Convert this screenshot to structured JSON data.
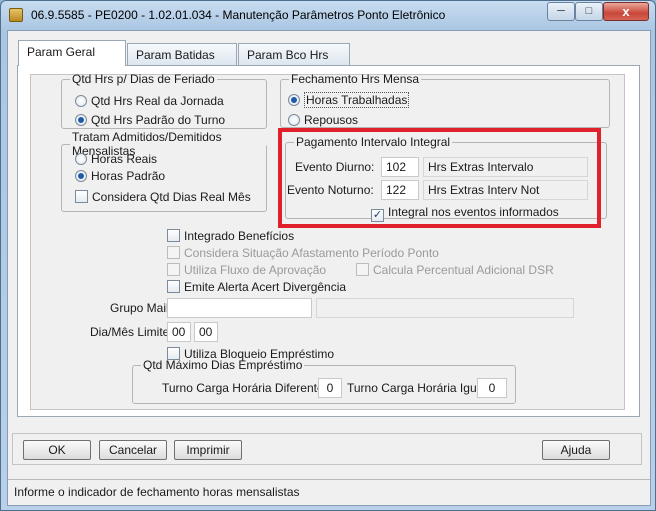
{
  "window": {
    "title": "06.9.5585 - PE0200 - 1.02.01.034 - Manutenção Parâmetros Ponto Eletrônico",
    "controls": {
      "close_label": "x"
    }
  },
  "tabs": [
    {
      "label": "Param Geral",
      "selected": true
    },
    {
      "label": "Param Batidas",
      "selected": false
    },
    {
      "label": "Param Bco Hrs",
      "selected": false
    }
  ],
  "feriado": {
    "legend": "Qtd Hrs p/ Dias de Feriado",
    "options": [
      {
        "label": "Qtd Hrs Real da Jornada",
        "selected": false
      },
      {
        "label": "Qtd Hrs Padrão do Turno",
        "selected": true
      }
    ]
  },
  "fechamento": {
    "legend": "Fechamento Hrs Mensa",
    "options": [
      {
        "label": "Horas Trabalhadas",
        "selected": true
      },
      {
        "label": "Repousos",
        "selected": false
      }
    ]
  },
  "admitidos": {
    "legend": "Tratam Admitidos/Demitidos Mensalistas",
    "options": [
      {
        "label": "Horas Reais",
        "selected": false
      },
      {
        "label": "Horas Padrão",
        "selected": true
      }
    ],
    "checkbox": {
      "label": "Considera Qtd Dias Real Mês",
      "checked": false
    }
  },
  "intervalo": {
    "legend": "Pagamento Intervalo Integral",
    "diurno": {
      "label": "Evento Diurno:",
      "code": "102",
      "description": "Hrs Extras Intervalo"
    },
    "noturno": {
      "label": "Evento Noturno:",
      "code": "122",
      "description": "Hrs Extras Interv Not"
    },
    "integral": {
      "label": "Integral nos eventos informados",
      "checked": true
    }
  },
  "options": {
    "integrado_beneficios": {
      "label": "Integrado Benefícios",
      "checked": false,
      "enabled": true
    },
    "considera_situacao": {
      "label": "Considera Situação Afastamento Período Ponto",
      "checked": false,
      "enabled": false
    },
    "utiliza_fluxo": {
      "label": "Utiliza Fluxo de Aprovação",
      "checked": false,
      "enabled": false
    },
    "calcula_percentual": {
      "label": "Calcula Percentual Adicional DSR",
      "checked": false,
      "enabled": false
    },
    "emite_alerta": {
      "label": "Emite Alerta Acert Divergência",
      "checked": false,
      "enabled": true
    }
  },
  "grupo_mail": {
    "label": "Grupo Mail:",
    "value": "",
    "description": ""
  },
  "dia_mes_limite": {
    "label": "Dia/Mês Limite:",
    "day": "00",
    "month": "00"
  },
  "bloqueio_emprestimo": {
    "label": "Utiliza Bloqueio Empréstimo",
    "checked": false
  },
  "emprestimo": {
    "legend": "Qtd Máximo Dias Empréstimo",
    "turno_diferente": {
      "label": "Turno Carga Horária Diferente:",
      "value": "0"
    },
    "turno_igual": {
      "label": "Turno Carga Horária Igual:",
      "value": "0"
    }
  },
  "buttons": {
    "ok": "OK",
    "cancelar": "Cancelar",
    "imprimir": "Imprimir",
    "ajuda": "Ajuda"
  },
  "status_bar": "Informe o indicador de fechamento horas mensalistas",
  "colors": {
    "highlight_box": "#e0202b",
    "radio_dot": "#1e5aa8"
  }
}
